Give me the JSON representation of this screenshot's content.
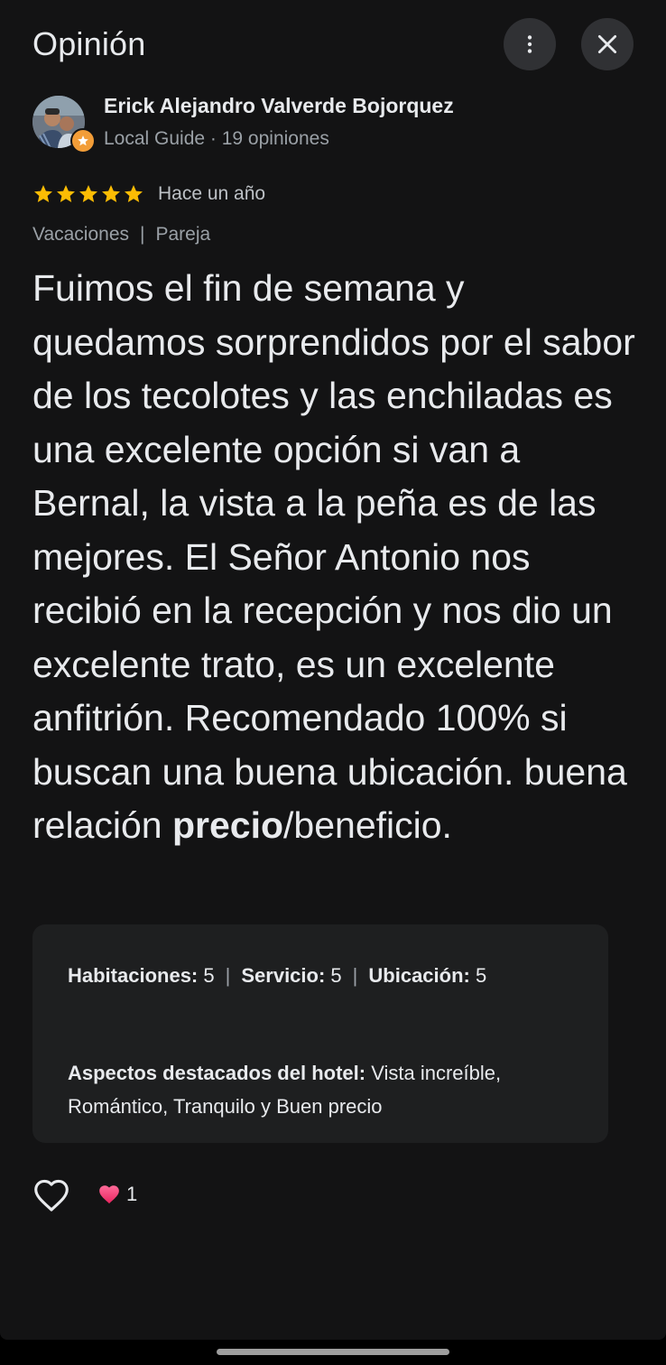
{
  "header": {
    "title": "Opinión",
    "more_icon": "more-vert-icon",
    "close_icon": "close-icon"
  },
  "author": {
    "name": "Erick Alejandro Valverde Bojorquez",
    "meta": "Local Guide · 19 opiniones",
    "badge_icon": "local-guide-star-icon"
  },
  "review": {
    "rating": 5,
    "rating_max": 5,
    "star_color": "#fbbc04",
    "time_ago": "Hace un año",
    "tags": [
      "Vacaciones",
      "Pareja"
    ],
    "tag_separator": "|",
    "text_before_bold": "Fuimos el fin de semana y quedamos sorprendidos por el sabor de los tecolotes y las enchiladas es una excelente opción si van a Bernal, la vista a la peña es de las mejores. El Señor Antonio nos recibió en la recepción y nos dio un excelente trato, es un excelente anfitrión. Recomendado 100% si buscan una buena ubicación. buena relación ",
    "text_bold": "precio",
    "text_after_bold": "/beneficio."
  },
  "sub_ratings": [
    {
      "label": "Habitaciones:",
      "value": "5"
    },
    {
      "label": "Servicio:",
      "value": "5"
    },
    {
      "label": "Ubicación:",
      "value": "5"
    }
  ],
  "sub_ratings_separator": "|",
  "highlights": {
    "label": "Aspectos destacados del hotel:",
    "value": " Vista increíble, Romántico, Tranquilo y Buen precio"
  },
  "reactions": {
    "like_icon": "heart-outline-icon",
    "reaction_icon": "heart-filled-icon",
    "count": "1"
  },
  "colors": {
    "background": "#131314",
    "card": "#1e1f20",
    "button": "#303134",
    "text_primary": "#e8eaed",
    "text_secondary": "#9aa0a6",
    "badge": "#f29d38",
    "heart_pink": "#f0447a"
  }
}
